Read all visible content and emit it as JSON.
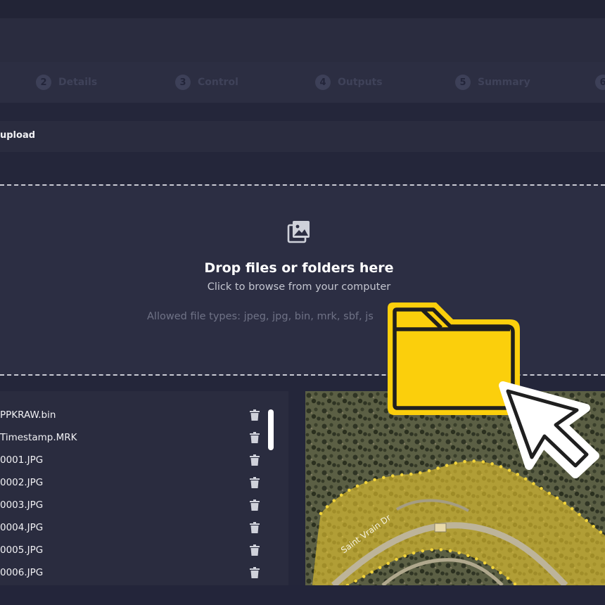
{
  "stepper": {
    "steps": [
      {
        "num": "2",
        "label": "Details"
      },
      {
        "num": "3",
        "label": "Control"
      },
      {
        "num": "4",
        "label": "Outputs"
      },
      {
        "num": "5",
        "label": "Summary"
      },
      {
        "num": "6",
        "label": ""
      }
    ]
  },
  "upload": {
    "section_title": "upload",
    "drop_title": "Drop files or folders here",
    "drop_subtitle": "Click to browse from your computer",
    "allowed_types": "Allowed file types: jpeg, jpg, bin, mrk, sbf, js"
  },
  "files": [
    {
      "name": "PPKRAW.bin"
    },
    {
      "name": "Timestamp.MRK"
    },
    {
      "name": "0001.JPG"
    },
    {
      "name": "0002.JPG"
    },
    {
      "name": "0003.JPG"
    },
    {
      "name": "0004.JPG"
    },
    {
      "name": "0005.JPG"
    },
    {
      "name": "0006.JPG"
    }
  ],
  "map": {
    "road_label": "Saint Vrain Dr"
  },
  "colors": {
    "background": "#24263a",
    "accent_yellow": "#fbcf0c",
    "overlay_yellow": "#e7c52d"
  },
  "icons": {
    "drop": "image-stack-icon",
    "file_action": "trash-icon",
    "folder": "folder-icon",
    "cursor": "pointer-cursor-icon"
  }
}
